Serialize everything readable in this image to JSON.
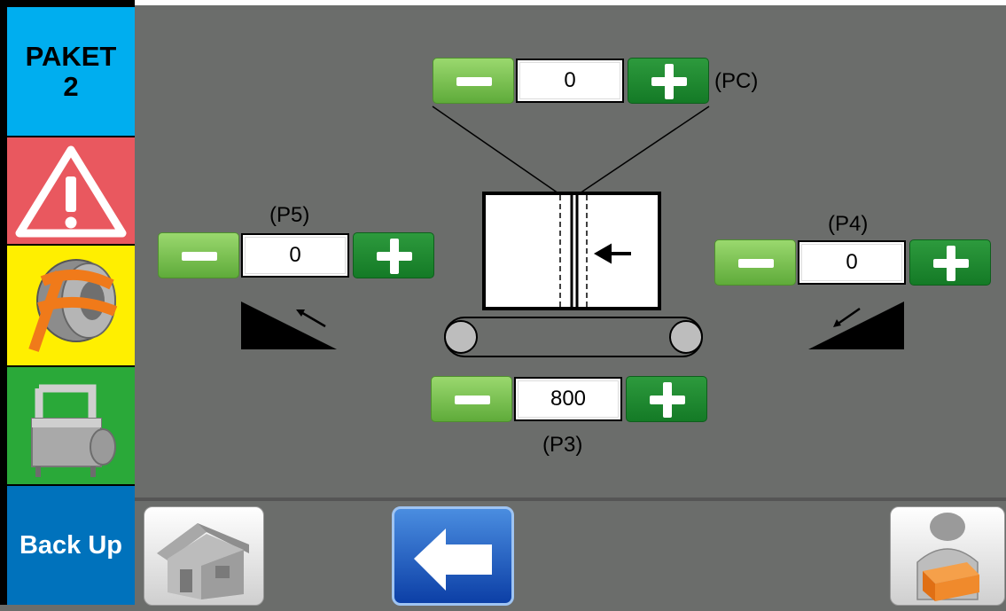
{
  "sidebar": {
    "paket_label": "PAKET\n2",
    "alarm_icon": "warning-icon",
    "strap_icon": "strap-roll-icon",
    "machine_icon": "strapping-machine-icon",
    "backup_label": "Back Up",
    "colors": {
      "paket": "#00aeef",
      "alarm": "#e9585f",
      "strap": "#ffef00",
      "machine": "#2aa939",
      "backup": "#0072bc"
    }
  },
  "params": {
    "pc": {
      "label": "(PC)",
      "value": "0"
    },
    "p5": {
      "label": "(P5)",
      "value": "0"
    },
    "p4": {
      "label": "(P4)",
      "value": "0"
    },
    "p3": {
      "label": "(P3)",
      "value": "800"
    }
  },
  "bottom": {
    "home_icon": "home-icon",
    "back_icon": "back-arrow-icon",
    "operator_icon": "operator-package-icon"
  }
}
